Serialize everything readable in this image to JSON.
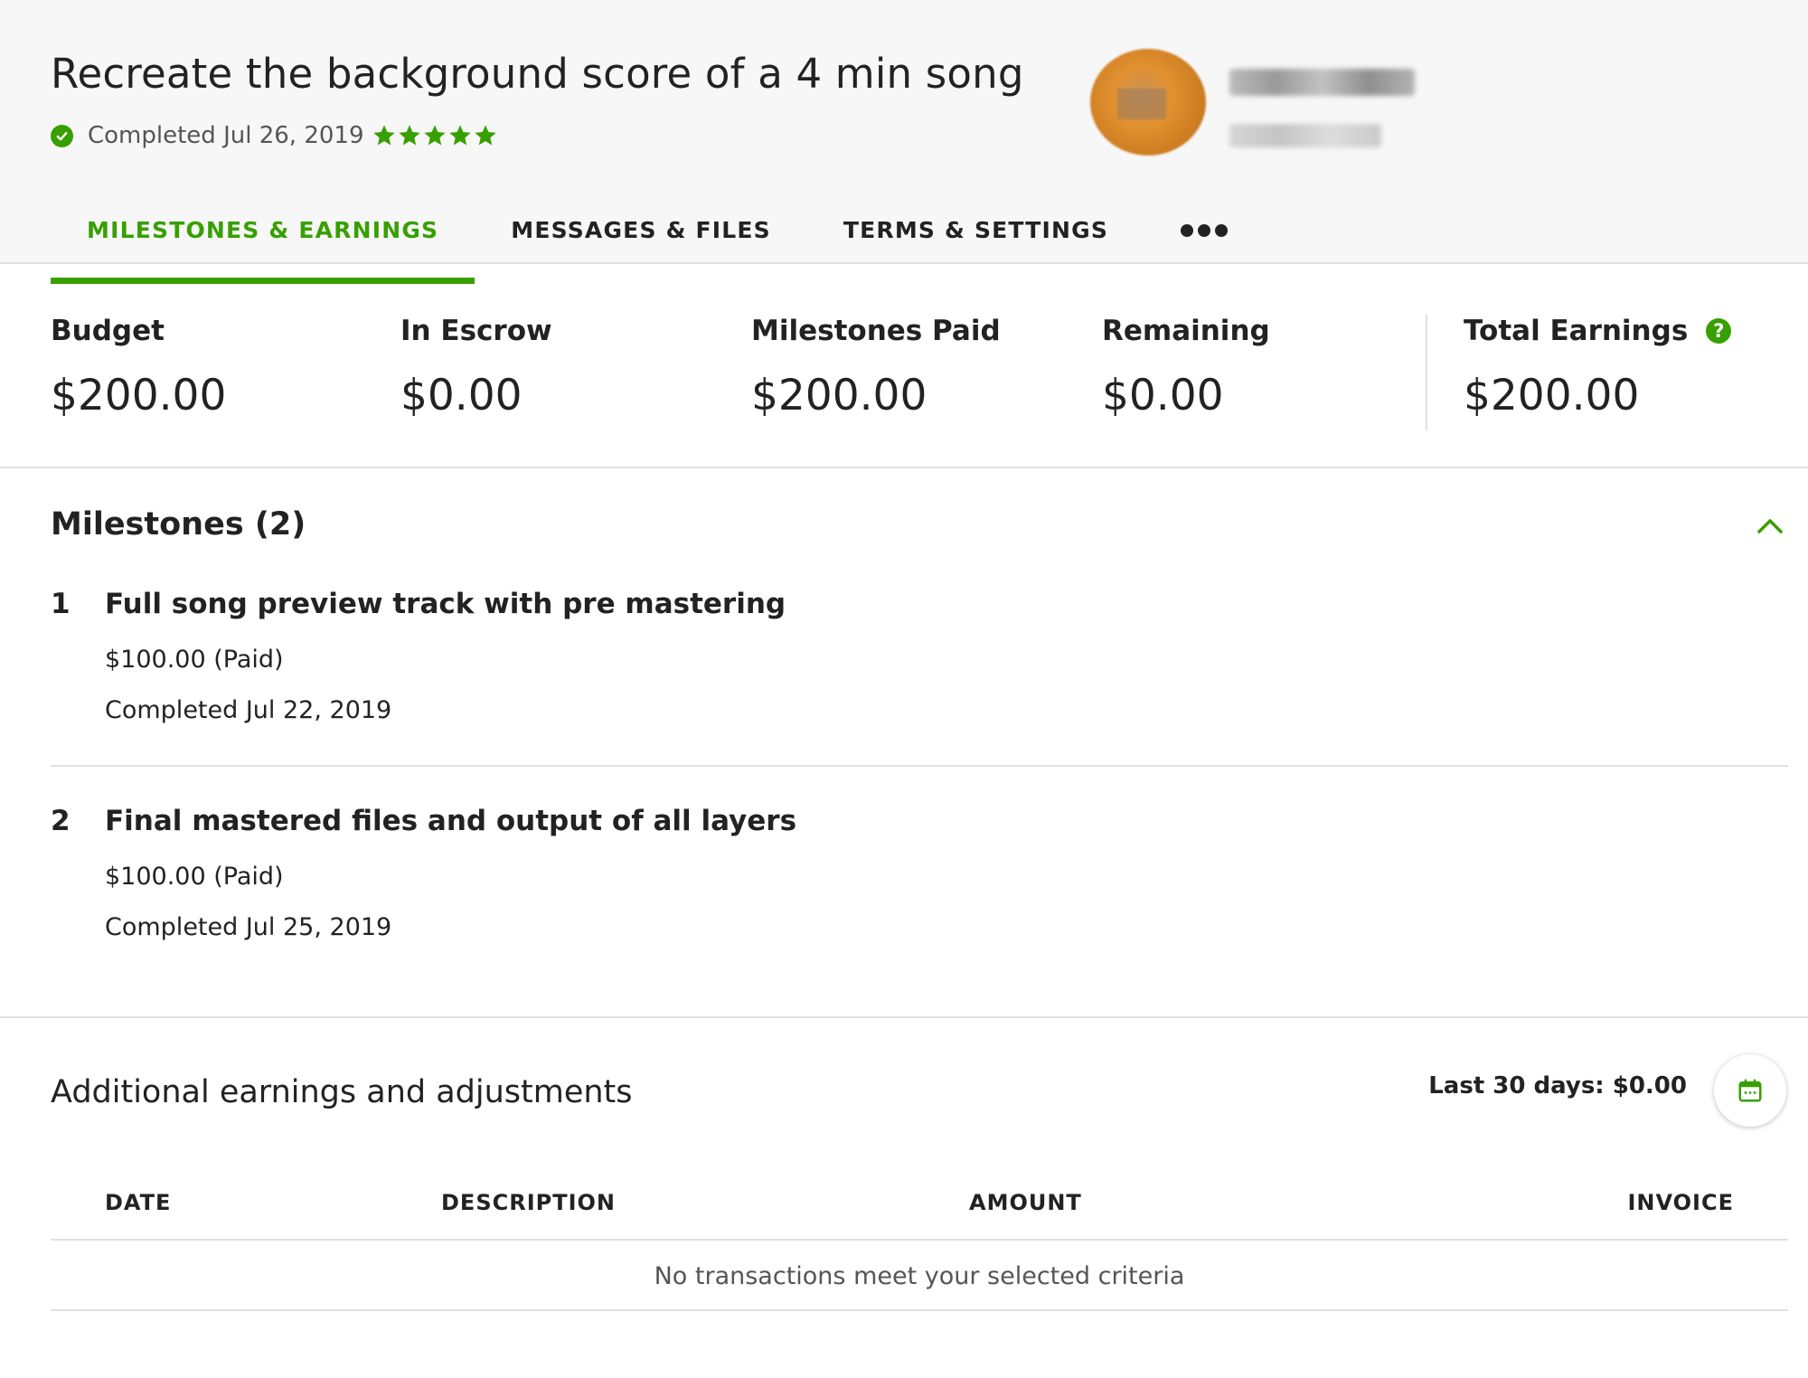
{
  "header": {
    "title": "Recreate the background score of a 4 min song",
    "status": "Completed Jul 26, 2019",
    "rating_stars": 5,
    "accent_color": "#37a000"
  },
  "tabs": [
    {
      "label": "MILESTONES & EARNINGS",
      "active": true
    },
    {
      "label": "MESSAGES & FILES",
      "active": false
    },
    {
      "label": "TERMS & SETTINGS",
      "active": false
    }
  ],
  "stats": {
    "budget": {
      "label": "Budget",
      "value": "$200.00"
    },
    "escrow": {
      "label": "In Escrow",
      "value": "$0.00"
    },
    "paid": {
      "label": "Milestones Paid",
      "value": "$200.00"
    },
    "remaining": {
      "label": "Remaining",
      "value": "$0.00"
    },
    "total": {
      "label": "Total Earnings",
      "value": "$200.00",
      "help": "?"
    }
  },
  "milestones": {
    "heading": "Milestones (2)",
    "items": [
      {
        "num": "1",
        "title": "Full song preview track with pre mastering",
        "amount": "$100.00 (Paid)",
        "date": "Completed Jul 22, 2019"
      },
      {
        "num": "2",
        "title": "Final mastered files and output of all layers",
        "amount": "$100.00 (Paid)",
        "date": "Completed Jul 25, 2019"
      }
    ]
  },
  "adjustments": {
    "heading": "Additional earnings and adjustments",
    "last30": "Last 30 days: $0.00",
    "columns": {
      "date": "DATE",
      "description": "DESCRIPTION",
      "amount": "AMOUNT",
      "invoice": "INVOICE"
    },
    "empty_message": "No transactions meet your selected criteria"
  },
  "icons": {
    "status": "check-circle-icon",
    "rating": "star-icon",
    "more": "more-dots-icon",
    "help": "help-circle-icon",
    "collapse": "chevron-up-icon",
    "calendar": "calendar-icon"
  }
}
